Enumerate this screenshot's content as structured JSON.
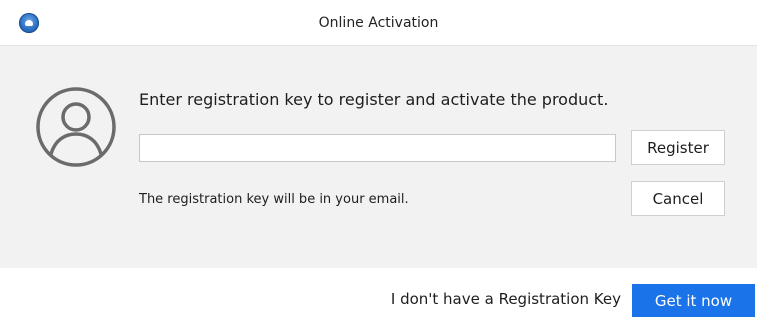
{
  "window": {
    "title": "Online Activation",
    "icon": "app-logo-icon"
  },
  "content": {
    "avatar_icon": "user-avatar-icon",
    "prompt": "Enter registration key to register and activate the product.",
    "key_input": {
      "value": "",
      "placeholder": ""
    },
    "hint": "The registration key will be in your email.",
    "register_label": "Register",
    "cancel_label": "Cancel"
  },
  "footer": {
    "no_key_text": "I don't have a Registration Key",
    "get_it_now_label": "Get it now"
  },
  "colors": {
    "accent": "#1a73e8",
    "panel_background": "#f2f2f2",
    "avatar_stroke": "#6b6b6b"
  }
}
